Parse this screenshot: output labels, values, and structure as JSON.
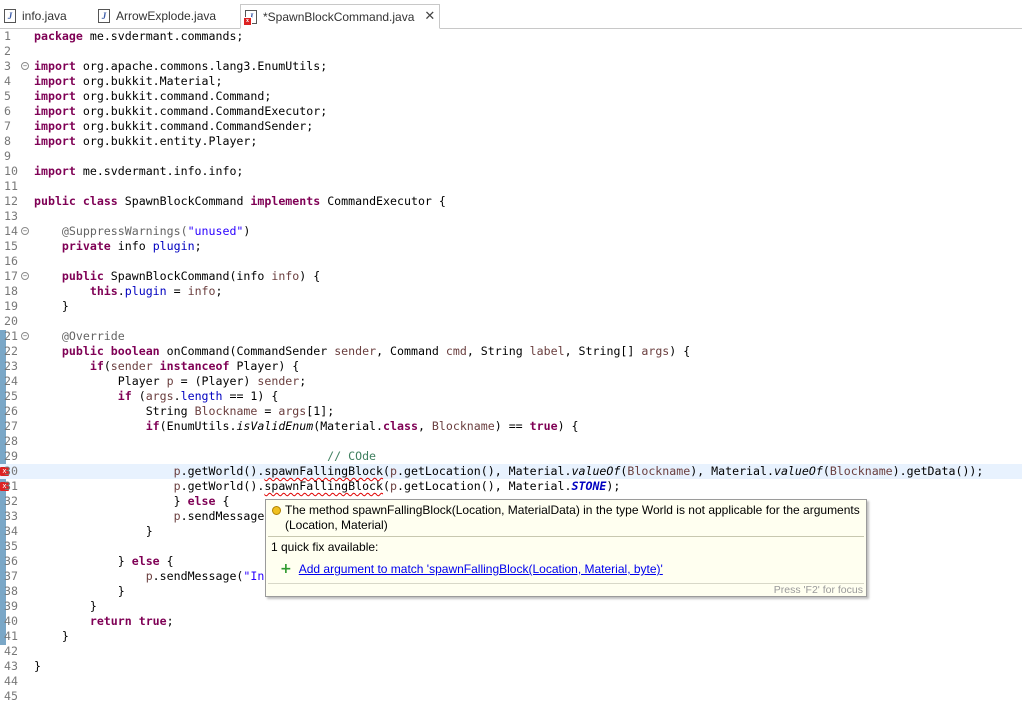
{
  "tabs": [
    {
      "label": "info.java",
      "active": false
    },
    {
      "label": "ArrowExplode.java",
      "active": false
    },
    {
      "label": "*SpawnBlockCommand.java",
      "active": true
    }
  ],
  "lines": [
    "1",
    "2",
    "3",
    "4",
    "5",
    "6",
    "7",
    "8",
    "9",
    "10",
    "11",
    "12",
    "13",
    "14",
    "15",
    "16",
    "17",
    "18",
    "19",
    "20",
    "21",
    "22",
    "23",
    "24",
    "25",
    "26",
    "27",
    "28",
    "29",
    "30",
    "31",
    "32",
    "33",
    "34",
    "35",
    "36",
    "37",
    "38",
    "39",
    "40",
    "41",
    "42",
    "43",
    "44",
    "45"
  ],
  "code": {
    "l1": {
      "kw": "package",
      "rest": " me.svdermant.commands;"
    },
    "imp": "import",
    "l3": " org.apache.commons.lang3.EnumUtils;",
    "l4": " org.bukkit.Material;",
    "l5": " org.bukkit.command.Command;",
    "l6": " org.bukkit.command.CommandExecutor;",
    "l7": " org.bukkit.command.CommandSender;",
    "l8": " org.bukkit.entity.Player;",
    "l10": " me.svdermant.info.info;",
    "l12": {
      "kw1": "public",
      "kw2": "class",
      "name": " SpawnBlockCommand ",
      "kw3": "implements",
      "rest": " CommandExecutor {"
    },
    "l14": {
      "ann": "@SuppressWarnings(",
      "str": "\"unused\"",
      "close": ")"
    },
    "l15": {
      "kw": "private",
      "type": " info ",
      "fld": "plugin",
      "end": ";"
    },
    "l17": {
      "kw": "public",
      "a": " SpawnBlockCommand(info ",
      "var": "info",
      "b": ") {"
    },
    "l18": {
      "kw": "this",
      "a": ".",
      "fld": "plugin",
      "b": " = ",
      "var": "info",
      "c": ";"
    },
    "brace_close": "}",
    "l21": "@Override",
    "l22": {
      "kw1": "public",
      "kw2": "boolean",
      "a": " onCommand(CommandSender ",
      "v1": "sender",
      "b": ", Command ",
      "v2": "cmd",
      "c": ", String ",
      "v3": "label",
      "d": ", String[] ",
      "v4": "args",
      "e": ") {"
    },
    "l23": {
      "kw1": "if",
      "a": "(",
      "v": "sender",
      "kw2": " instanceof",
      "b": " Player) {"
    },
    "l24": {
      "a": "Player ",
      "v1": "p",
      "b": " = (Player) ",
      "v2": "sender",
      "c": ";"
    },
    "l25": {
      "kw": "if",
      "a": " (",
      "v": "args",
      "b": ".",
      "fld": "length",
      "c": " == 1) {"
    },
    "l26": {
      "a": "String ",
      "v1": "Blockname",
      "b": " = ",
      "v2": "args",
      "c": "[1];"
    },
    "l27": {
      "kw": "if",
      "a": "(EnumUtils.",
      "it": "isValidEnum",
      "b": "(Material.",
      "kw2": "class",
      "c": ", ",
      "v": "Blockname",
      "d": ") == ",
      "kw3": "true",
      "e": ") {"
    },
    "l29": "// COde",
    "l30": {
      "v1": "p",
      "a": ".getWorld().",
      "err": "spawnFallingBlock",
      "b": "(",
      "v2": "p",
      "c": ".getLocation(), Material.",
      "it1": "valueOf",
      "d": "(",
      "v3": "Blockname",
      "e": "), Material.",
      "it2": "valueOf",
      "f": "(",
      "v4": "Blockname",
      "g": ").getData());"
    },
    "l31": {
      "v1": "p",
      "a": ".getWorld().",
      "err": "spawnFallingBlock",
      "b": "(",
      "v2": "p",
      "c": ".getLocation(), Material.",
      "cst": "STONE",
      "d": ");"
    },
    "l32": {
      "a": "} ",
      "kw": "else",
      "b": " {"
    },
    "l33": {
      "v": "p",
      "a": ".sendMessage"
    },
    "l36": {
      "a": "} ",
      "kw": "else",
      "b": " {"
    },
    "l37": {
      "v": "p",
      "a": ".sendMessage(",
      "str": "\"In"
    },
    "l40": {
      "kw": "return",
      "a": " ",
      "kw2": "true",
      "b": ";"
    }
  },
  "popup": {
    "message": "The method spawnFallingBlock(Location, MaterialData) in the type World is not applicable for the arguments (Location, Material)",
    "count": "1 quick fix available:",
    "fix": "Add argument to match 'spawnFallingBlock(Location, Material, byte)'",
    "footer": "Press 'F2' for focus"
  },
  "colors": {
    "keyword": "#7f0055",
    "string": "#2a00ff",
    "field": "#0000c0",
    "comment": "#3f7f5f",
    "error": "#e00000"
  },
  "icons": {
    "tab_file": "java-file-icon",
    "tab_error_file": "java-file-error-icon",
    "close": "close-icon",
    "fold": "fold-collapse-icon",
    "error_marker": "error-marker-icon",
    "quick_fix": "plus-icon",
    "problem": "error-icon"
  }
}
